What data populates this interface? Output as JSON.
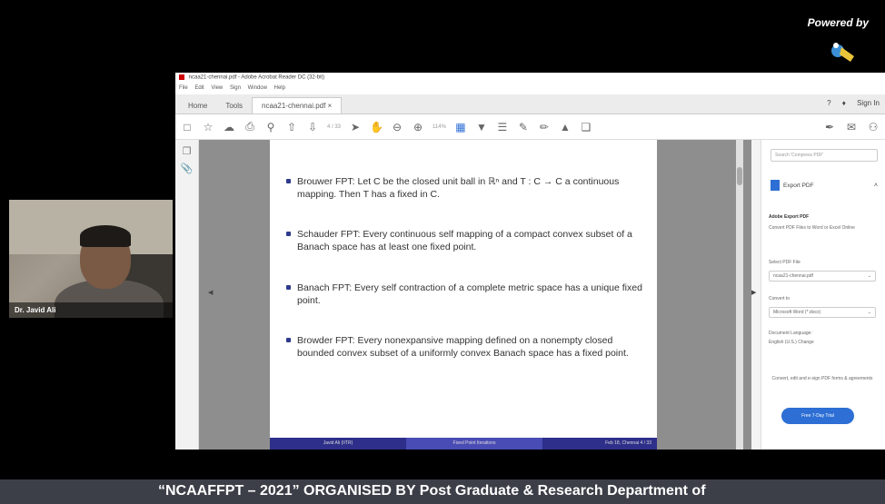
{
  "overlay": {
    "powered_by": "Powered by",
    "banner": "“NCAAFFPT – 2021” ORGANISED BY Post Graduate & Research Department of"
  },
  "webcam": {
    "name": "Dr. Javid Ali"
  },
  "acrobat": {
    "title": "ncaa21-chennai.pdf - Adobe Acrobat Reader DC (32-bit)",
    "menu": [
      "File",
      "Edit",
      "View",
      "Sign",
      "Window",
      "Help"
    ],
    "tabs": {
      "home": "Home",
      "tools": "Tools",
      "document": "ncaa21-chennai.pdf ×"
    },
    "top_right": {
      "help": "?",
      "sign_in": "Sign In"
    },
    "toolbar": {
      "page_indicator": "4 / 33",
      "zoom": "114%"
    },
    "slide": {
      "bullets": [
        "Brouwer FPT: Let C be the closed unit ball in ℝⁿ and T : C → C a continuous mapping. Then T has a fixed in C.",
        "Schauder FPT: Every continuous self mapping of a compact convex subset of a Banach space has at least one fixed point.",
        "Banach FPT: Every self contraction of a complete metric space has a unique fixed point.",
        "Browder FPT: Every nonexpansive mapping defined on a nonempty closed bounded convex subset of a uniformly convex Banach space has a fixed point."
      ],
      "footer": {
        "left": "Javid Ali (IITR)",
        "center": "Fixed Point Iterations",
        "right": "Feb 18, Chennai 4 / 33"
      }
    },
    "right_panel": {
      "search_placeholder": "Search 'Compress PDF'",
      "export_label": "Export PDF",
      "export_heading": "Adobe Export PDF",
      "export_desc": "Convert PDF Files to Word or Excel Online",
      "select_file_label": "Select PDF File",
      "select_file_value": "ncaa21-chennai.pdf",
      "convert_to_label": "Convert to",
      "convert_to_value": "Microsoft Word (*.docx)",
      "doc_language_label": "Document Language:",
      "doc_language_value": "English (U.S.) Change",
      "promo_text": "Convert, edit and e-sign PDF forms & agreements",
      "trial_button": "Free 7-Day Trial"
    }
  }
}
